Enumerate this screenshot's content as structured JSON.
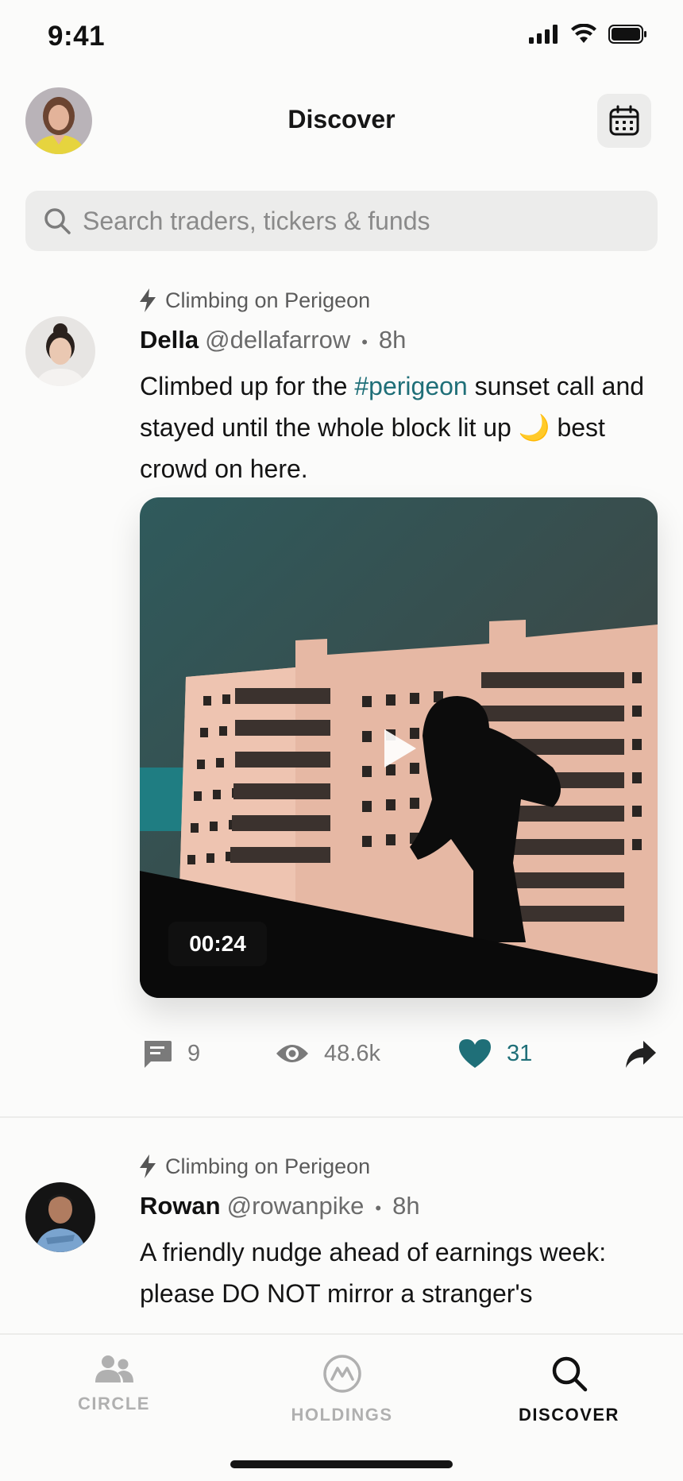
{
  "status_bar": {
    "time": "9:41"
  },
  "header": {
    "title": "Discover",
    "avatar_icon": "user-avatar",
    "calendar_icon": "calendar-icon"
  },
  "search": {
    "placeholder": "Search traders, tickers & funds"
  },
  "posts": [
    {
      "context": "Climbing on Perigeon",
      "name": "Della",
      "handle": "@dellafarrow",
      "time": "8h",
      "body_before": "Climbed up for the ",
      "hashtag": "#perigeon",
      "body_after": " sunset call and stayed until the whole block lit up 🌙 best crowd on here.",
      "video_duration": "00:24",
      "comments": "9",
      "views": "48.6k",
      "likes": "31"
    },
    {
      "context": "Climbing on Perigeon",
      "name": "Rowan",
      "handle": "@rowanpike",
      "time": "8h",
      "body": "A friendly nudge ahead of earnings week: please DO NOT mirror a stranger's"
    }
  ],
  "tabs": [
    {
      "label": "CIRCLE",
      "icon": "people-icon",
      "active": false
    },
    {
      "label": "HOLDINGS",
      "icon": "chart-circle-icon",
      "active": false
    },
    {
      "label": "DISCOVER",
      "icon": "search-icon",
      "active": true
    }
  ],
  "colors": {
    "accent": "#1f6f78",
    "background": "#fbfbfa",
    "inactive_tab": "#b0b0b0"
  }
}
